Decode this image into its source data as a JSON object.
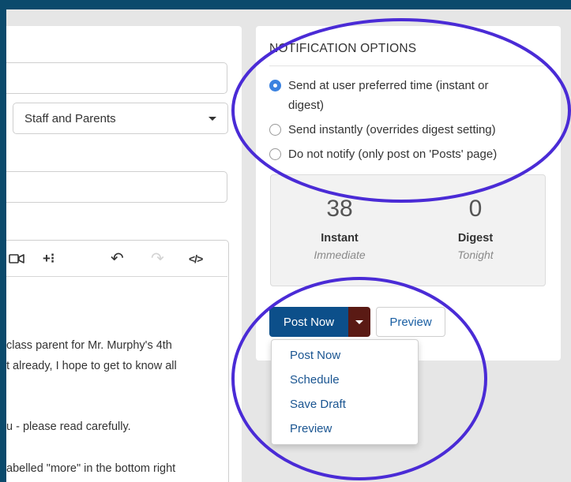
{
  "left": {
    "audience_select": "Staff and Parents",
    "editor_lines": [
      "class parent for Mr. Murphy's 4th",
      "t already, I hope to get to know all",
      "u - please read carefully.",
      "abelled \"more\" in the bottom right"
    ]
  },
  "notification": {
    "heading": "NOTIFICATION OPTIONS",
    "options": [
      {
        "line1": "Send at user preferred time (instant or",
        "line2": "digest)",
        "checked": true
      },
      {
        "line1": "Send instantly (overrides digest setting)",
        "checked": false
      },
      {
        "line1": "Do not notify (only post on 'Posts' page)",
        "checked": false
      }
    ]
  },
  "stats": {
    "instant": {
      "count": "38",
      "label": "Instant",
      "sub": "Immediate"
    },
    "digest": {
      "count": "0",
      "label": "Digest",
      "sub": "Tonight"
    }
  },
  "actions": {
    "post_now": "Post Now",
    "preview": "Preview"
  },
  "menu": {
    "items": [
      "Post Now",
      "Schedule",
      "Save Draft",
      "Preview"
    ]
  },
  "colors": {
    "frame": "#0b4a6c",
    "primary": "#0c4f8a",
    "caret_button": "#5a1a14",
    "radio_checked": "#3b82e0",
    "annotation": "#4a2bd6"
  },
  "icons": {
    "toolbar": [
      "video-icon",
      "add-more-icon",
      "undo-icon",
      "redo-icon",
      "code-icon"
    ]
  }
}
